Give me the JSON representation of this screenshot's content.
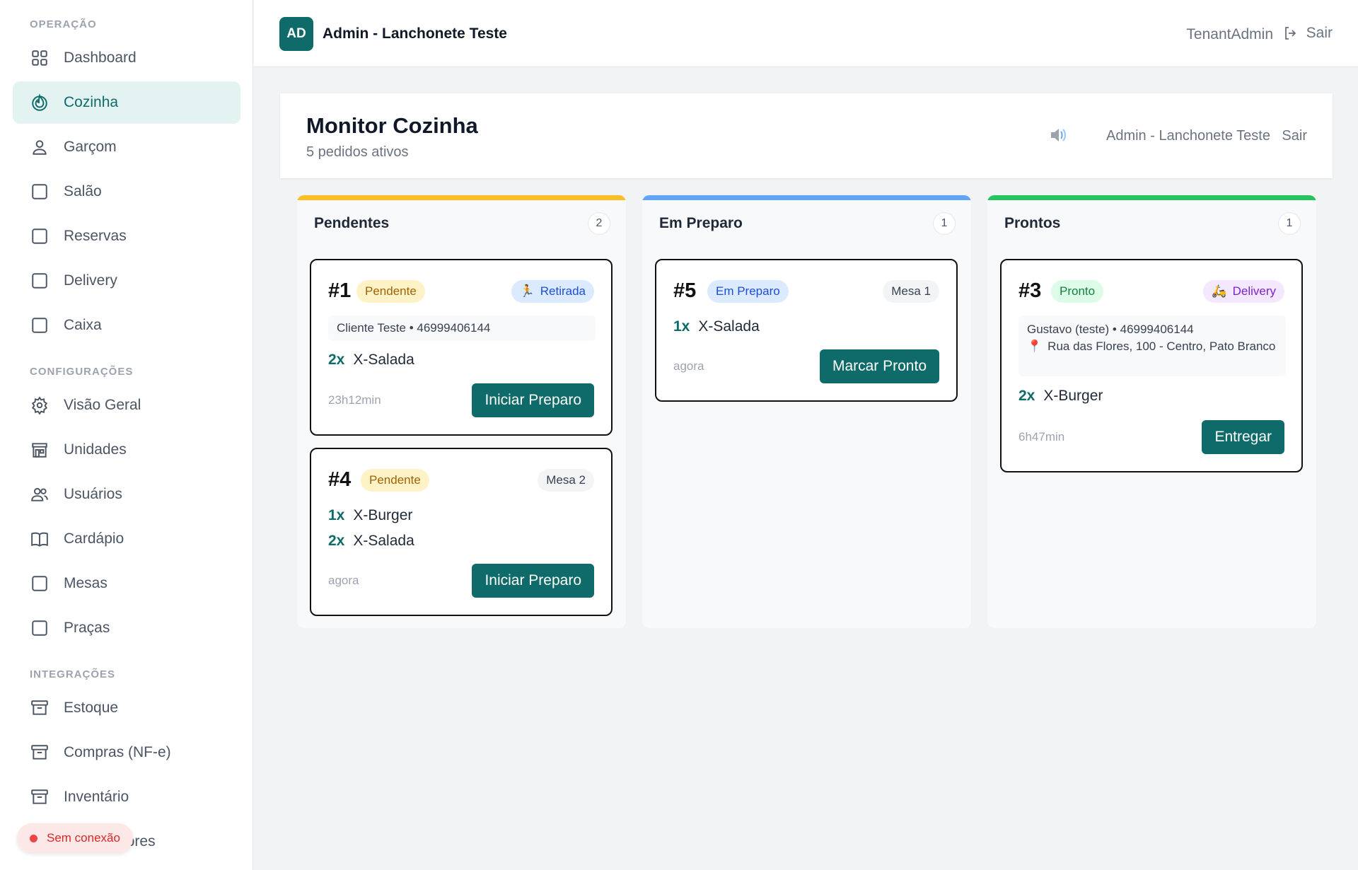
{
  "sidebar": {
    "sections": [
      {
        "title": "OPERAÇÃO",
        "items": [
          {
            "label": "Dashboard",
            "icon": "grid-icon"
          },
          {
            "label": "Cozinha",
            "icon": "flame-icon",
            "active": true
          },
          {
            "label": "Garçom",
            "icon": "user-icon"
          },
          {
            "label": "Salão",
            "icon": "square-icon"
          },
          {
            "label": "Reservas",
            "icon": "square-icon"
          },
          {
            "label": "Delivery",
            "icon": "square-icon"
          },
          {
            "label": "Caixa",
            "icon": "square-icon"
          }
        ]
      },
      {
        "title": "CONFIGURAÇÕES",
        "items": [
          {
            "label": "Visão Geral",
            "icon": "gear-icon"
          },
          {
            "label": "Unidades",
            "icon": "store-icon"
          },
          {
            "label": "Usuários",
            "icon": "users-icon"
          },
          {
            "label": "Cardápio",
            "icon": "book-icon"
          },
          {
            "label": "Mesas",
            "icon": "square-icon"
          },
          {
            "label": "Praças",
            "icon": "square-icon"
          }
        ]
      },
      {
        "title": "INTEGRAÇÕES",
        "items": [
          {
            "label": "Estoque",
            "icon": "archive-icon"
          },
          {
            "label": "Compras (NF-e)",
            "icon": "archive-icon"
          },
          {
            "label": "Inventário",
            "icon": "archive-icon"
          },
          {
            "label": "Fornecedores",
            "icon": "archive-icon"
          }
        ]
      }
    ],
    "offline_label": "Sem conexão"
  },
  "topbar": {
    "avatar": "AD",
    "title": "Admin - Lanchonete Teste",
    "user": "TenantAdmin",
    "logout": "Sair"
  },
  "header": {
    "title": "Monitor Cozinha",
    "subtitle": "5 pedidos ativos",
    "tenant": "Admin - Lanchonete Teste",
    "logout": "Sair"
  },
  "columns": [
    {
      "title": "Pendentes",
      "count": "2",
      "color": "#fbbf24"
    },
    {
      "title": "Em Preparo",
      "count": "1",
      "color": "#60a5fa"
    },
    {
      "title": "Prontos",
      "count": "1",
      "color": "#22c55e"
    }
  ],
  "orders": {
    "o1": {
      "num": "#1",
      "status": "Pendente",
      "tag": "Retirada",
      "info": "Cliente Teste • 46999406144",
      "items": [
        {
          "q": "2x",
          "name": "X-Salada"
        }
      ],
      "time": "23h12min",
      "action": "Iniciar Preparo"
    },
    "o4": {
      "num": "#4",
      "status": "Pendente",
      "tag": "Mesa 2",
      "items": [
        {
          "q": "1x",
          "name": "X-Burger"
        },
        {
          "q": "2x",
          "name": "X-Salada"
        }
      ],
      "time": "agora",
      "action": "Iniciar Preparo"
    },
    "o5": {
      "num": "#5",
      "status": "Em Preparo",
      "tag": "Mesa 1",
      "items": [
        {
          "q": "1x",
          "name": "X-Salada"
        }
      ],
      "time": "agora",
      "action": "Marcar Pronto"
    },
    "o3": {
      "num": "#3",
      "status": "Pronto",
      "tag": "Delivery",
      "info": "Gustavo (teste) • 46999406144",
      "address": "Rua das Flores, 100 - Centro, Pato Branco",
      "items": [
        {
          "q": "2x",
          "name": "X-Burger"
        }
      ],
      "time": "6h47min",
      "action": "Entregar"
    }
  },
  "colors": {
    "accent": "#0e6b69",
    "pending": "#fbbf24",
    "preparing": "#60a5fa",
    "ready": "#22c55e"
  }
}
